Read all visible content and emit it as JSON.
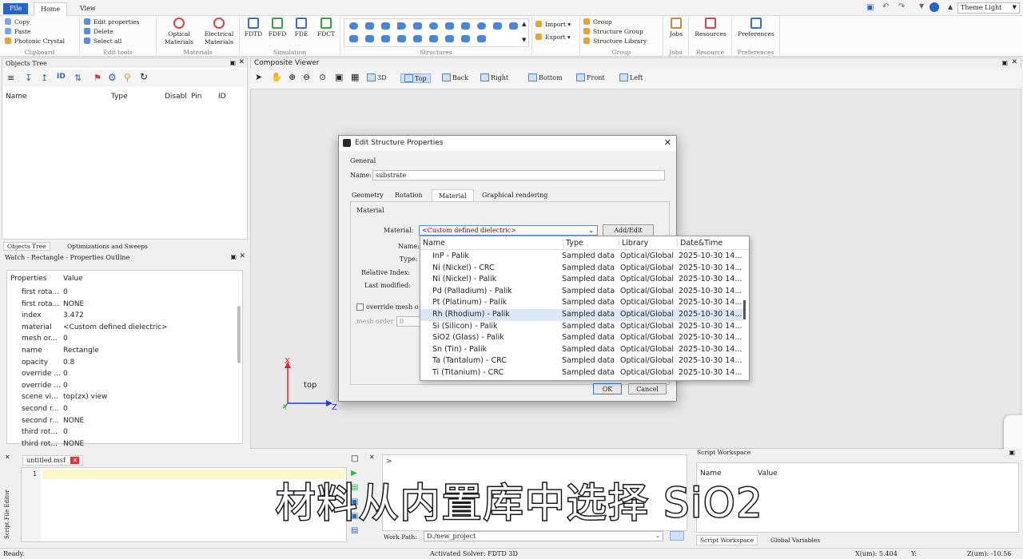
{
  "ribbon": {
    "tabs": [
      "File",
      "Home",
      "View"
    ],
    "clipboard": {
      "items": [
        "Copy",
        "Paste",
        "Photonic Crystal"
      ],
      "label": "Clipboard"
    },
    "edit": {
      "items": [
        "Edit properties",
        "Delete",
        "Select all"
      ],
      "label": "Edit tools"
    },
    "materials": {
      "optical": "Optical Materials",
      "electrical": "Electrical Materials",
      "label": "Materials"
    },
    "simulation": {
      "items": [
        "FDTD",
        "FDFD",
        "FDE",
        "FDCT"
      ],
      "label": "Simulation"
    },
    "structures": {
      "label": "Structures"
    },
    "importexport": [
      "Import",
      "Export"
    ],
    "group": {
      "items": [
        "Group",
        "Structure Group",
        "Structure Library"
      ],
      "label": "Group"
    },
    "jobs": {
      "item": "Jobs",
      "label": "Jobs"
    },
    "resource": {
      "item": "Resources",
      "label": "Resource"
    },
    "preferences": {
      "item": "Preferences",
      "label": "Preferences"
    },
    "theme": "Theme Light"
  },
  "objects_tree": {
    "title": "Objects Tree",
    "columns": [
      "Name",
      "Type",
      "Disabl",
      "Pin",
      "ID"
    ],
    "tabs": [
      "Objects Tree",
      "Optimizations and Sweeps"
    ]
  },
  "properties": {
    "title": "Watch - Rectangle - Properties Outline",
    "col_prop": "Properties",
    "col_value": "Value",
    "rows": [
      {
        "k": "first rota...",
        "v": "0"
      },
      {
        "k": "first rota...",
        "v": "NONE"
      },
      {
        "k": "index",
        "v": "3.472"
      },
      {
        "k": "material",
        "v": "<Custom defined dielectric>"
      },
      {
        "k": "mesh or...",
        "v": "0"
      },
      {
        "k": "name",
        "v": "Rectangle"
      },
      {
        "k": "opacity",
        "v": "0.8"
      },
      {
        "k": "override ...",
        "v": "0"
      },
      {
        "k": "override ...",
        "v": "0"
      },
      {
        "k": "scene vi...",
        "v": "top(zx) view"
      },
      {
        "k": "second r...",
        "v": "0"
      },
      {
        "k": "second r...",
        "v": "NONE"
      },
      {
        "k": "third rot...",
        "v": "0"
      },
      {
        "k": "third rot...",
        "v": "NONE"
      }
    ]
  },
  "viewer": {
    "title": "Composite Viewer",
    "views": [
      "3D",
      "Top",
      "Back",
      "Right",
      "Bottom",
      "Front",
      "Left"
    ],
    "axes": {
      "x": "X",
      "y": "Y",
      "z": "Z",
      "label": "top"
    }
  },
  "dialog": {
    "title": "Edit Structure Properties",
    "general": "General",
    "name_label": "Name:",
    "name_value": "substrate",
    "tabs": [
      "Geometry",
      "Rotation",
      "Material",
      "Graphical rendering"
    ],
    "material_section": "Material",
    "material_label": "Material:",
    "material_value": "<Custom defined dielectric>",
    "add_edit": "Add/Edit",
    "side_labels": [
      "Name:",
      "Type:",
      "Relative Index:",
      "Last modified:"
    ],
    "override": "override mesh o",
    "mesh_order": "mesh order",
    "mesh_order_value": "0",
    "ok": "OK",
    "cancel": "Cancel"
  },
  "dropdown": {
    "columns": [
      "Name",
      "Type",
      "Library",
      "Date&Time"
    ],
    "rows": [
      {
        "name": "InP - Palik",
        "type": "Sampled data",
        "lib": "Optical/Global",
        "date": "2025-10-30 14..."
      },
      {
        "name": "Ni (Nickel) - CRC",
        "type": "Sampled data",
        "lib": "Optical/Global",
        "date": "2025-10-30 14..."
      },
      {
        "name": "Ni (Nickel) - Palik",
        "type": "Sampled data",
        "lib": "Optical/Global",
        "date": "2025-10-30 14..."
      },
      {
        "name": "Pd (Palladium) - Palik",
        "type": "Sampled data",
        "lib": "Optical/Global",
        "date": "2025-10-30 14..."
      },
      {
        "name": "Pt (Platinum) - Palik",
        "type": "Sampled data",
        "lib": "Optical/Global",
        "date": "2025-10-30 14..."
      },
      {
        "name": "Rh (Rhodium) - Palik",
        "type": "Sampled data",
        "lib": "Optical/Global",
        "date": "2025-10-30 14..."
      },
      {
        "name": "Si (Silicon) - Palik",
        "type": "Sampled data",
        "lib": "Optical/Global",
        "date": "2025-10-30 14..."
      },
      {
        "name": "SiO2 (Glass) - Palik",
        "type": "Sampled data",
        "lib": "Optical/Global",
        "date": "2025-10-30 14..."
      },
      {
        "name": "Sn (Tin) - Palik",
        "type": "Sampled data",
        "lib": "Optical/Global",
        "date": "2025-10-30 14..."
      },
      {
        "name": "Ta (Tantalum) - CRC",
        "type": "Sampled data",
        "lib": "Optical/Global",
        "date": "2025-10-30 14..."
      },
      {
        "name": "Ti (Titanium) - CRC",
        "type": "Sampled data",
        "lib": "Optical/Global",
        "date": "2025-10-30 14..."
      }
    ],
    "hovered_index": 5
  },
  "editor": {
    "file": "untitled.msf",
    "line": "1",
    "side_label": "Script File Editor"
  },
  "console": {
    "prompt": ">",
    "workpath_label": "Work Path:",
    "workpath": "D:/new_project"
  },
  "workspace": {
    "title": "Script Workspace",
    "col_name": "Name",
    "col_value": "Value",
    "tabs": [
      "Script Workspace",
      "Global Variables"
    ]
  },
  "status": {
    "left": "Ready.",
    "solver": "Activated Solver: FDTD 3D",
    "x": "X(um): 5.404",
    "y": "Y:",
    "z": "Z(um): -10.56"
  },
  "subtitle": "材料从内置库中选择 SiO2"
}
